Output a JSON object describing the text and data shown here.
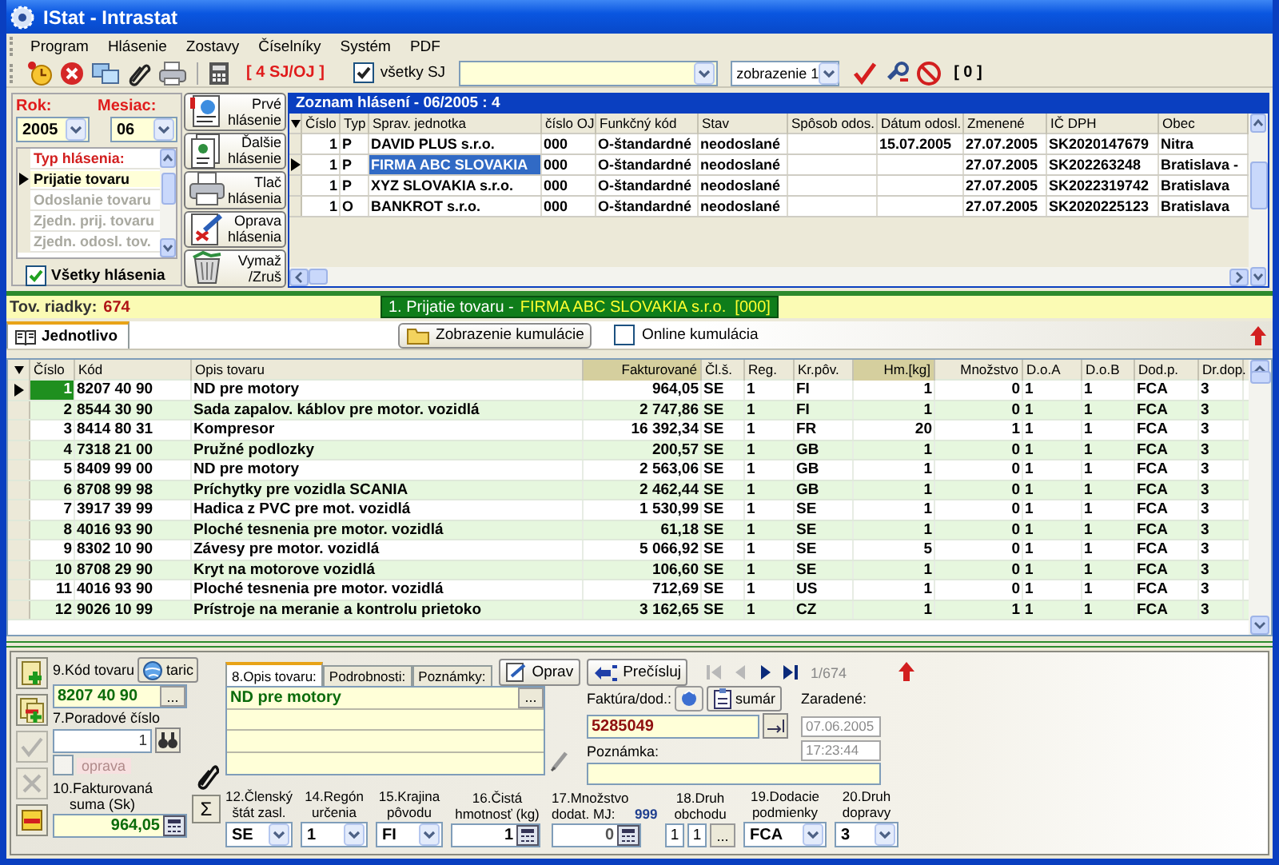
{
  "window": {
    "title": "IStat - Intrastat"
  },
  "menu": [
    {
      "label": "Program"
    },
    {
      "label": "Hlásenie"
    },
    {
      "label": "Zostavy"
    },
    {
      "label": "Číselníky"
    },
    {
      "label": "Systém"
    },
    {
      "label": "PDF"
    }
  ],
  "toolbar": {
    "units": "[ 4 SJ/OJ ]",
    "all_units": {
      "label": "všetky SJ",
      "checked": true
    },
    "view": "zobrazenie 1",
    "count": "[ 0 ]"
  },
  "filter": {
    "year_label": "Rok:",
    "year": "2005",
    "month_label": "Mesiac:",
    "month": "06",
    "types_heading": "Typ hlásenia:",
    "types": [
      {
        "label": "Prijatie tovaru",
        "selected": true,
        "disabled": false
      },
      {
        "label": "Odoslanie tovaru",
        "selected": false,
        "disabled": true
      },
      {
        "label": "Zjedn. prij. tovaru",
        "selected": false,
        "disabled": true
      },
      {
        "label": "Zjedn. odosl. tov.",
        "selected": false,
        "disabled": true
      }
    ],
    "all": {
      "label": "Všetky hlásenia",
      "checked": true
    }
  },
  "actions": [
    {
      "kind": "first",
      "label": "Prvé hlásenie"
    },
    {
      "kind": "next",
      "label": "Ďalšie hlásenie"
    },
    {
      "kind": "print",
      "label": "Tlač hlásenia"
    },
    {
      "kind": "edit",
      "label": "Oprava hlásenia"
    },
    {
      "kind": "delete",
      "label": "Vymaž /Zruš"
    }
  ],
  "reports": {
    "title": "Zoznam hlásení - 06/2005 : 4",
    "columns": [
      "Číslo",
      "Typ",
      "Sprav. jednotka",
      "číslo OJ",
      "Funkčný kód",
      "Stav",
      "Spôsob odos.",
      "Dátum odosl.",
      "Zmenené",
      "IČ DPH",
      "Obec"
    ],
    "rows": [
      {
        "selected": false,
        "cells": [
          "1",
          "P",
          "DAVID PLUS s.r.o.",
          "000",
          "O-štandardné",
          "neodoslané",
          "",
          "15.07.2005",
          "27.07.2005",
          "SK2020147679",
          "Nitra"
        ]
      },
      {
        "selected": true,
        "cells": [
          "1",
          "P",
          "FIRMA ABC SLOVAKIA",
          "000",
          "O-štandardné",
          "neodoslané",
          "",
          "",
          "27.07.2005",
          "SK202263248",
          "Bratislava -"
        ]
      },
      {
        "selected": false,
        "cells": [
          "1",
          "P",
          "XYZ SLOVAKIA  s.r.o.",
          "000",
          "O-štandardné",
          "neodoslané",
          "",
          "",
          "27.07.2005",
          "SK2022319742",
          "Bratislava"
        ]
      },
      {
        "selected": false,
        "cells": [
          "1",
          "O",
          "BANKROT s.r.o.",
          "000",
          "O-štandardné",
          "neodoslané",
          "",
          "",
          "27.07.2005",
          "SK2020225123",
          "Bratislava"
        ]
      }
    ]
  },
  "summary": {
    "label": "Tov. riadky:",
    "count": "674",
    "report_type": "1. Prijatie tovaru -",
    "report_unit": "FIRMA ABC SLOVAKIA s.r.o.  [000]"
  },
  "detail_tabs": [
    {
      "label": "Jednotlivo",
      "selected": true
    }
  ],
  "cumulation_button": "Zobrazenie kumulácie",
  "online": {
    "label": "Online kumulácia",
    "checked": false
  },
  "items": {
    "columns": [
      "Číslo",
      "Kód",
      "Opis tovaru",
      "Fakturované",
      "Čl.š.",
      "Reg.",
      "Kr.pôv.",
      "Hm.[kg]",
      "Množstvo",
      "D.o.A",
      "D.o.B",
      "Dod.p.",
      "Dr.dop."
    ],
    "rows": [
      {
        "selected": true,
        "cells": [
          "1",
          "8207 40 90",
          "ND pre motory",
          "964,05",
          "SE",
          "1",
          "FI",
          "1",
          "0",
          "1",
          "1",
          "FCA",
          "3"
        ]
      },
      {
        "selected": false,
        "cells": [
          "2",
          "8544 30 90",
          "Sada zapalov. káblov pre motor. vozidlá",
          "2 747,86",
          "SE",
          "1",
          "FI",
          "1",
          "0",
          "1",
          "1",
          "FCA",
          "3"
        ]
      },
      {
        "selected": false,
        "cells": [
          "3",
          "8414 80 31",
          "Kompresor",
          "16 392,34",
          "SE",
          "1",
          "FR",
          "20",
          "1",
          "1",
          "1",
          "FCA",
          "3"
        ]
      },
      {
        "selected": false,
        "cells": [
          "4",
          "7318 21 00",
          "Pružné podlozky",
          "200,57",
          "SE",
          "1",
          "GB",
          "1",
          "0",
          "1",
          "1",
          "FCA",
          "3"
        ]
      },
      {
        "selected": false,
        "cells": [
          "5",
          "8409 99 00",
          "ND pre motory",
          "2 563,06",
          "SE",
          "1",
          "GB",
          "1",
          "0",
          "1",
          "1",
          "FCA",
          "3"
        ]
      },
      {
        "selected": false,
        "cells": [
          "6",
          "8708 99 98",
          "Príchytky pre vozidla SCANIA",
          "2 462,44",
          "SE",
          "1",
          "GB",
          "1",
          "0",
          "1",
          "1",
          "FCA",
          "3"
        ]
      },
      {
        "selected": false,
        "cells": [
          "7",
          "3917 39 99",
          "Hadica z PVC pre mot. vozidlá",
          "1 530,99",
          "SE",
          "1",
          "SE",
          "1",
          "0",
          "1",
          "1",
          "FCA",
          "3"
        ]
      },
      {
        "selected": false,
        "cells": [
          "8",
          "4016 93 90",
          "Ploché tesnenia pre motor. vozidlá",
          "61,18",
          "SE",
          "1",
          "SE",
          "1",
          "0",
          "1",
          "1",
          "FCA",
          "3"
        ]
      },
      {
        "selected": false,
        "cells": [
          "9",
          "8302 10 90",
          "Závesy pre motor. vozidlá",
          "5 066,92",
          "SE",
          "1",
          "SE",
          "5",
          "0",
          "1",
          "1",
          "FCA",
          "3"
        ]
      },
      {
        "selected": false,
        "cells": [
          "10",
          "8708 29 90",
          "Kryt na motorove vozidlá",
          "106,60",
          "SE",
          "1",
          "SE",
          "1",
          "0",
          "1",
          "1",
          "FCA",
          "3"
        ]
      },
      {
        "selected": false,
        "cells": [
          "11",
          "4016 93 90",
          "Ploché tesnenia pre motor. vozidlá",
          "712,69",
          "SE",
          "1",
          "US",
          "1",
          "0",
          "1",
          "1",
          "FCA",
          "3"
        ]
      },
      {
        "selected": false,
        "cells": [
          "12",
          "9026 10 99",
          "Prístroje na meranie a kontrolu prietoko",
          "3 162,65",
          "SE",
          "1",
          "CZ",
          "1",
          "1",
          "1",
          "1",
          "FCA",
          "3"
        ]
      }
    ]
  },
  "form": {
    "tools": [
      {
        "kind": "add",
        "disabled": false
      },
      {
        "kind": "copy",
        "disabled": false
      },
      {
        "kind": "confirm",
        "disabled": true
      },
      {
        "kind": "cancel",
        "disabled": true
      },
      {
        "kind": "delete",
        "disabled": false
      }
    ],
    "code": {
      "label": "9.Kód tovaru",
      "button": "taric",
      "value": "8207 40 90",
      "browse": "..."
    },
    "sum_button": "Σ",
    "description_browse": "...",
    "order": {
      "label": "7.Poradové číslo",
      "value": "1"
    },
    "correction": {
      "label": "oprava",
      "checked": false,
      "disabled": true
    },
    "amount": {
      "label": "10.Fakturovaná suma (Sk)",
      "value": "964,05"
    },
    "tabs": [
      {
        "label": "8.Opis tovaru:",
        "selected": true
      },
      {
        "label": "Podrobnosti:",
        "selected": false
      },
      {
        "label": "Poznámky:",
        "selected": false
      }
    ],
    "edit_button": "Oprav",
    "renumber_button": "Prečísluj",
    "nav": [
      {
        "kind": "first",
        "disabled": true
      },
      {
        "kind": "prev",
        "disabled": true
      },
      {
        "kind": "next",
        "disabled": false
      },
      {
        "kind": "last",
        "disabled": false
      }
    ],
    "position": "1/674",
    "description": "ND pre motory",
    "invoice": {
      "label": "Faktúra/dod.:",
      "button": "sumár",
      "value": "5285049"
    },
    "note_label": "Poznámka:",
    "assigned": {
      "label": "Zaradené:",
      "date": "07.06.2005",
      "time": "17:23:44"
    },
    "fields": [
      {
        "kind": "combo",
        "label": "12.Členský štát zasl.",
        "value": "SE"
      },
      {
        "kind": "combo",
        "label": "14.Regón určenia",
        "value": "1"
      },
      {
        "kind": "combo",
        "label": "15.Krajina pôvodu",
        "value": "FI"
      },
      {
        "kind": "calc",
        "label": "16.Čistá hmotnosť (kg)",
        "value": "1"
      },
      {
        "kind": "calc",
        "label": "17.Množstvo dodat. MJ:",
        "unit": "999",
        "value": "0"
      },
      {
        "kind": "pair",
        "label": "18.Druh obchodu",
        "values": [
          "1",
          "1"
        ],
        "browse": "..."
      },
      {
        "kind": "combo",
        "label": "19.Dodacie podmienky",
        "value": "FCA"
      },
      {
        "kind": "combo",
        "label": "20.Druh dopravy",
        "value": "3"
      }
    ]
  }
}
